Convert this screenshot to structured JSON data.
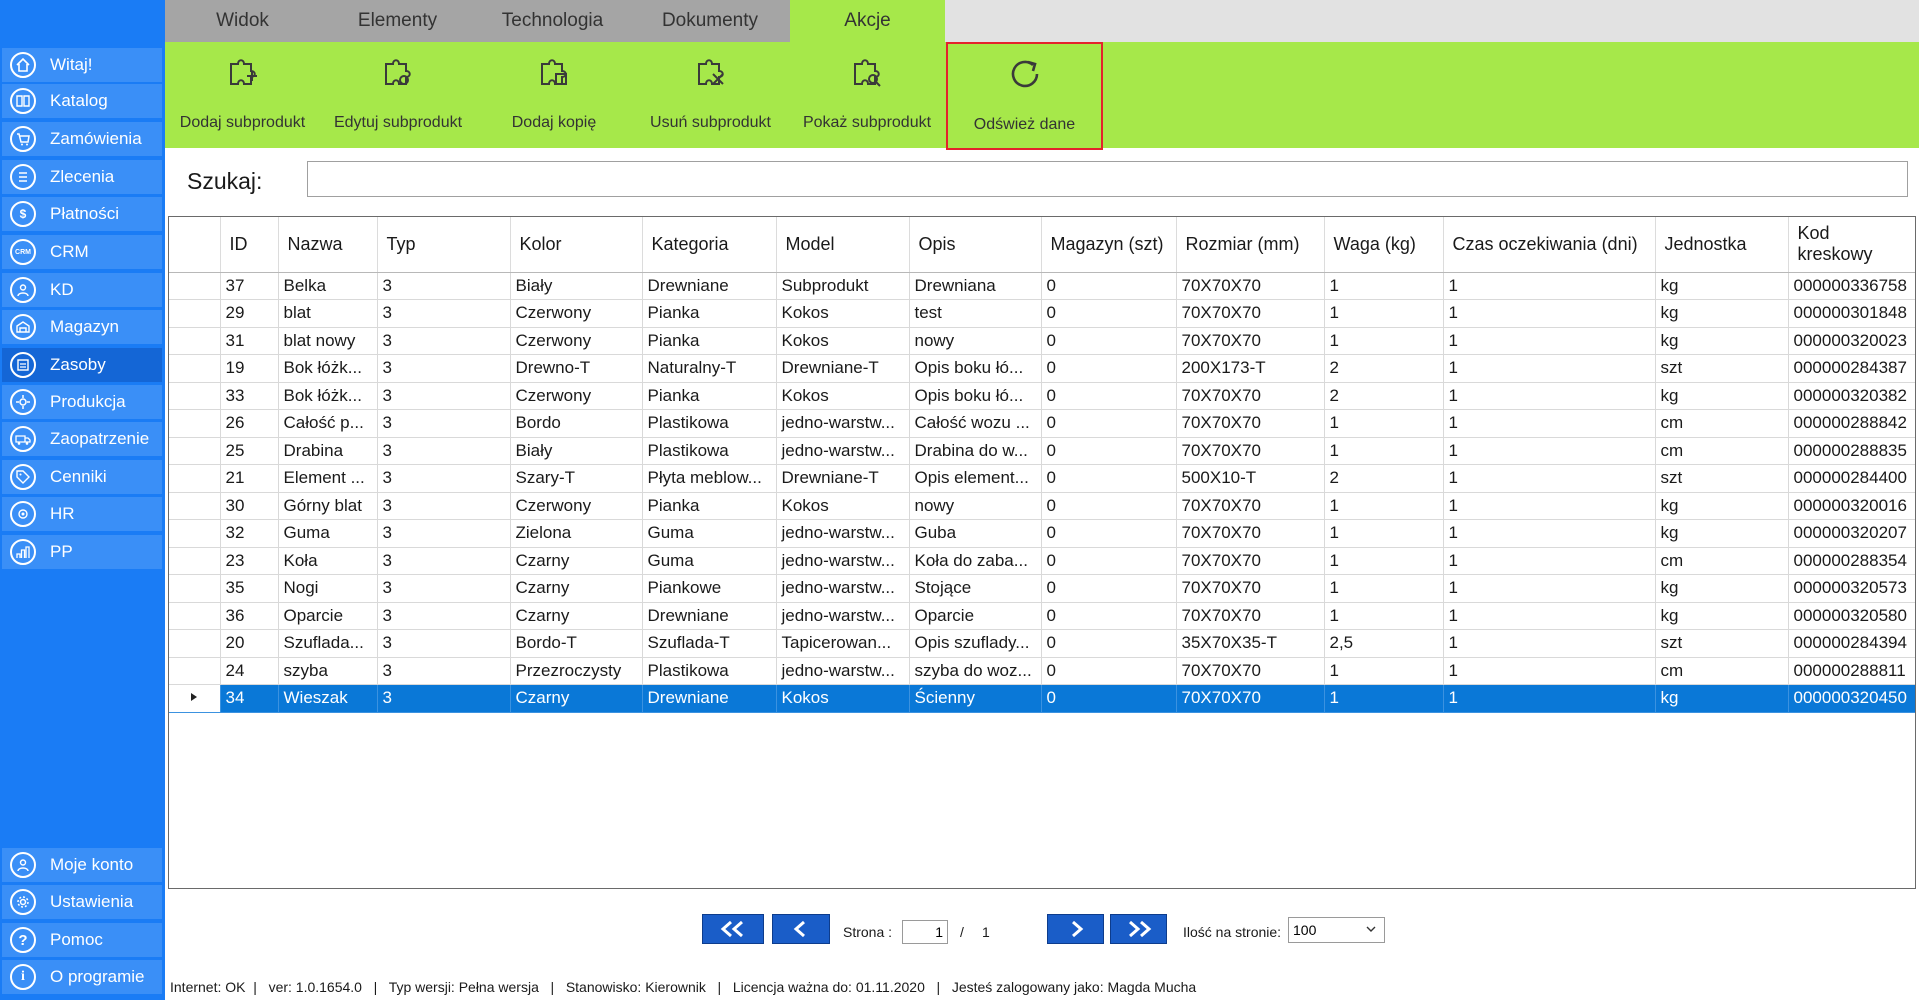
{
  "sidebar": {
    "items": [
      {
        "label": "Witaj!",
        "icon": "home-icon"
      },
      {
        "label": "Katalog",
        "icon": "book-icon"
      },
      {
        "label": "Zamówienia",
        "icon": "cart-icon"
      },
      {
        "label": "Zlecenia",
        "icon": "list-icon"
      },
      {
        "label": "Płatności",
        "icon": "dollar-icon"
      },
      {
        "label": "CRM",
        "icon": "crm-icon"
      },
      {
        "label": "KD",
        "icon": "user-badge-icon"
      },
      {
        "label": "Magazyn",
        "icon": "warehouse-icon"
      },
      {
        "label": "Zasoby",
        "icon": "resources-icon"
      },
      {
        "label": "Produkcja",
        "icon": "production-icon"
      },
      {
        "label": "Zaopatrzenie",
        "icon": "truck-icon"
      },
      {
        "label": "Cenniki",
        "icon": "tag-icon"
      },
      {
        "label": "HR",
        "icon": "hr-icon"
      },
      {
        "label": "PP",
        "icon": "chart-icon"
      }
    ],
    "bottom_items": [
      {
        "label": "Moje konto",
        "icon": "user-icon"
      },
      {
        "label": "Ustawienia",
        "icon": "gear-icon"
      },
      {
        "label": "Pomoc",
        "icon": "question-icon"
      },
      {
        "label": "O programie",
        "icon": "info-icon"
      }
    ]
  },
  "tabs": [
    {
      "label": "Widok"
    },
    {
      "label": "Elementy"
    },
    {
      "label": "Technologia"
    },
    {
      "label": "Dokumenty"
    },
    {
      "label": "Akcje"
    }
  ],
  "ribbon": {
    "buttons": [
      {
        "label": "Dodaj subprodukt",
        "icon": "puzzle-add-icon"
      },
      {
        "label": "Edytuj subprodukt",
        "icon": "puzzle-edit-icon"
      },
      {
        "label": "Dodaj kopię",
        "icon": "puzzle-copy-icon"
      },
      {
        "label": "Usuń subprodukt",
        "icon": "puzzle-delete-icon"
      },
      {
        "label": "Pokaż subprodukt",
        "icon": "puzzle-show-icon"
      },
      {
        "label": "Odśwież dane",
        "icon": "refresh-icon"
      }
    ]
  },
  "search": {
    "label": "Szukaj:",
    "value": ""
  },
  "table": {
    "columns": [
      {
        "label": "ID"
      },
      {
        "label": "Nazwa"
      },
      {
        "label": "Typ"
      },
      {
        "label": "Kolor"
      },
      {
        "label": "Kategoria"
      },
      {
        "label": "Model"
      },
      {
        "label": "Opis"
      },
      {
        "label": "Magazyn (szt)"
      },
      {
        "label": "Rozmiar (mm)"
      },
      {
        "label": "Waga (kg)"
      },
      {
        "label": "Czas oczekiwania (dni)"
      },
      {
        "label": "Jednostka"
      },
      {
        "label": "Kod kreskowy"
      }
    ],
    "rows": [
      [
        "37",
        "Belka",
        "3",
        "Biały",
        "Drewniane",
        "Subprodukt",
        "Drewniana",
        "0",
        "70X70X70",
        "1",
        "1",
        "kg",
        "000000336758"
      ],
      [
        "29",
        "blat",
        "3",
        "Czerwony",
        "Pianka",
        "Kokos",
        "test",
        "0",
        "70X70X70",
        "1",
        "1",
        "kg",
        "000000301848"
      ],
      [
        "31",
        "blat nowy",
        "3",
        "Czerwony",
        "Pianka",
        "Kokos",
        "nowy",
        "0",
        "70X70X70",
        "1",
        "1",
        "kg",
        "000000320023"
      ],
      [
        "19",
        "Bok łóżk...",
        "3",
        "Drewno-T",
        "Naturalny-T",
        "Drewniane-T",
        "Opis boku łó...",
        "0",
        "200X173-T",
        "2",
        "1",
        "szt",
        "000000284387"
      ],
      [
        "33",
        "Bok łóżk...",
        "3",
        "Czerwony",
        "Pianka",
        "Kokos",
        "Opis boku łó...",
        "0",
        "70X70X70",
        "2",
        "1",
        "kg",
        "000000320382"
      ],
      [
        "26",
        "Całość p...",
        "3",
        "Bordo",
        "Plastikowa",
        "jedno-warstw...",
        "Całość wozu ...",
        "0",
        "70X70X70",
        "1",
        "1",
        "cm",
        "000000288842"
      ],
      [
        "25",
        "Drabina",
        "3",
        "Biały",
        "Plastikowa",
        "jedno-warstw...",
        "Drabina do w...",
        "0",
        "70X70X70",
        "1",
        "1",
        "cm",
        "000000288835"
      ],
      [
        "21",
        "Element ...",
        "3",
        "Szary-T",
        "Płyta meblow...",
        "Drewniane-T",
        "Opis element...",
        "0",
        "500X10-T",
        "2",
        "1",
        "szt",
        "000000284400"
      ],
      [
        "30",
        "Górny blat",
        "3",
        "Czerwony",
        "Pianka",
        "Kokos",
        "nowy",
        "0",
        "70X70X70",
        "1",
        "1",
        "kg",
        "000000320016"
      ],
      [
        "32",
        "Guma",
        "3",
        "Zielona",
        "Guma",
        "jedno-warstw...",
        "Guba",
        "0",
        "70X70X70",
        "1",
        "1",
        "kg",
        "000000320207"
      ],
      [
        "23",
        "Koła",
        "3",
        "Czarny",
        "Guma",
        "jedno-warstw...",
        "Koła do zaba...",
        "0",
        "70X70X70",
        "1",
        "1",
        "cm",
        "000000288354"
      ],
      [
        "35",
        "Nogi",
        "3",
        "Czarny",
        "Piankowe",
        "jedno-warstw...",
        "Stojące",
        "0",
        "70X70X70",
        "1",
        "1",
        "kg",
        "000000320573"
      ],
      [
        "36",
        "Oparcie",
        "3",
        "Czarny",
        "Drewniane",
        "jedno-warstw...",
        "Oparcie",
        "0",
        "70X70X70",
        "1",
        "1",
        "kg",
        "000000320580"
      ],
      [
        "20",
        "Szuflada...",
        "3",
        "Bordo-T",
        "Szuflada-T",
        "Tapicerowan...",
        "Opis szuflady...",
        "0",
        "35X70X35-T",
        "2,5",
        "1",
        "szt",
        "000000284394"
      ],
      [
        "24",
        "szyba",
        "3",
        "Przezroczysty",
        "Plastikowa",
        "jedno-warstw...",
        "szyba do woz...",
        "0",
        "70X70X70",
        "1",
        "1",
        "cm",
        "000000288811"
      ],
      [
        "34",
        "Wieszak",
        "3",
        "Czarny",
        "Drewniane",
        "Kokos",
        "Ścienny",
        "0",
        "70X70X70",
        "1",
        "1",
        "kg",
        "000000320450"
      ]
    ]
  },
  "pager": {
    "page_label": "Strona :",
    "page_value": "1",
    "separator": "/",
    "total_pages": "1",
    "per_page_label": "Ilość na stronie:",
    "per_page_value": "100"
  },
  "status": {
    "text": "Internet: OK  |   ver: 1.0.1654.0   |   Typ wersji: Pełna wersja   |   Stanowisko: Kierownik   |   Licencja ważna do: 01.11.2020   |   Jesteś zalogowany jako: Magda Mucha"
  },
  "colors": {
    "sidebar": "#1a7cf5",
    "ribbon": "#a6e84a",
    "selection": "#0a78d7",
    "highlight": "#e3232c",
    "pager_button": "#1a5dc8"
  }
}
